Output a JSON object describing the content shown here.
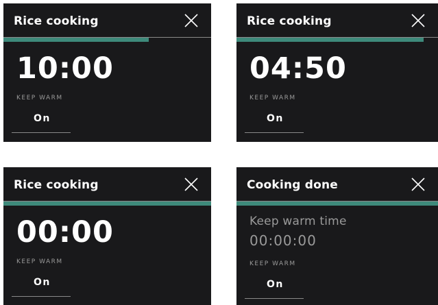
{
  "colors": {
    "screen_background": "#19191b",
    "accent_progress": "#3e8a7b",
    "text_primary": "#ffffff",
    "text_secondary": "#9a9a9a"
  },
  "screens": [
    {
      "title": "Rice cooking",
      "close_icon": "close-icon",
      "progress": 0.7,
      "time": "10:00",
      "keep_warm_label": "KEEP WARM",
      "keep_warm_value": "On"
    },
    {
      "title": "Rice cooking",
      "close_icon": "close-icon",
      "progress": 0.93,
      "time": "04:50",
      "keep_warm_label": "KEEP WARM",
      "keep_warm_value": "On"
    },
    {
      "title": "Rice cooking",
      "close_icon": "close-icon",
      "progress": 1.0,
      "time": "00:00",
      "keep_warm_label": "KEEP WARM",
      "keep_warm_value": "On"
    },
    {
      "title": "Cooking done",
      "close_icon": "close-icon",
      "progress": 1.0,
      "keep_warm_time_label": "Keep warm time",
      "keep_warm_time": "00:00:00",
      "keep_warm_label": "KEEP WARM",
      "keep_warm_value": "On"
    }
  ]
}
